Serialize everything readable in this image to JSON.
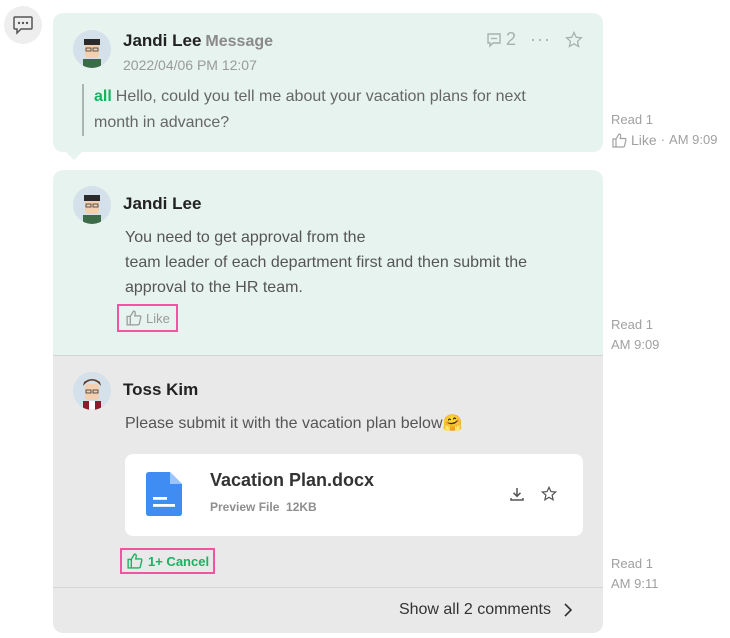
{
  "thread": {
    "root": {
      "author": "Jandi Lee",
      "label": "Message",
      "datetime": "2022/04/06 PM 12:07",
      "mention": "all",
      "text": "Hello, could you tell me about your vacation plans for next month in advance?",
      "comment_count": "2",
      "meta": {
        "read": "Read 1",
        "like": "Like",
        "dot": "·",
        "time": "AM 9:09"
      }
    },
    "reply1": {
      "author": "Jandi Lee",
      "line1": "You need to get approval from the",
      "line2": "team leader of each department first and then submit the",
      "line3": "approval to the HR team.",
      "like_label": "Like",
      "meta": {
        "read": "Read 1",
        "time": "AM 9:09"
      }
    },
    "reply2": {
      "author": "Toss Kim",
      "text": "Please submit it with the vacation plan below",
      "emoji": "🤗",
      "file": {
        "name": "Vacation Plan.docx",
        "preview": "Preview File",
        "size": "12KB"
      },
      "like_label": "1+ Cancel",
      "meta": {
        "read": "Read 1",
        "time": "AM 9:11"
      }
    },
    "show_all": "Show all 2 comments"
  },
  "colors": {
    "accent_green": "#1bb163",
    "highlight_pink": "#f0569f",
    "card_mint": "#e7f3ef",
    "card_grey": "#e9e9e9"
  },
  "icons": [
    "chat-bubble-icon",
    "comment-icon",
    "more-icon",
    "star-icon",
    "thumbs-up-icon",
    "docx-file-icon",
    "download-icon",
    "chevron-right-icon"
  ]
}
